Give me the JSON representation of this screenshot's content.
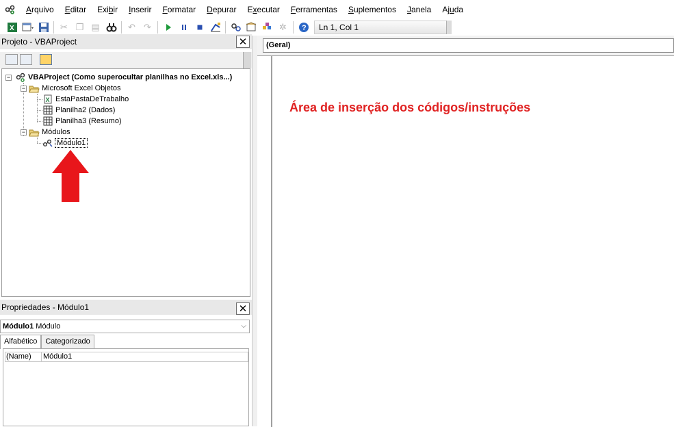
{
  "menubar": {
    "items": [
      {
        "pre": "",
        "u": "A",
        "post": "rquivo"
      },
      {
        "pre": "",
        "u": "E",
        "post": "ditar"
      },
      {
        "pre": "Exi",
        "u": "b",
        "post": "ir"
      },
      {
        "pre": "",
        "u": "I",
        "post": "nserir"
      },
      {
        "pre": "",
        "u": "F",
        "post": "ormatar"
      },
      {
        "pre": "",
        "u": "D",
        "post": "epurar"
      },
      {
        "pre": "E",
        "u": "x",
        "post": "ecutar"
      },
      {
        "pre": "",
        "u": "F",
        "post": "erramentas"
      },
      {
        "pre": "",
        "u": "S",
        "post": "uplementos"
      },
      {
        "pre": "",
        "u": "J",
        "post": "anela"
      },
      {
        "pre": "Aj",
        "u": "u",
        "post": "da"
      }
    ]
  },
  "toolbar": {
    "position_text": "Ln 1, Col 1",
    "icons": [
      "excel-icon",
      "insert-userform-icon",
      "save-icon",
      "cut-icon",
      "copy-icon",
      "paste-icon",
      "find-icon",
      "undo-icon",
      "redo-icon",
      "run-icon",
      "break-icon",
      "reset-icon",
      "design-mode-icon",
      "project-explorer-icon",
      "properties-window-icon",
      "object-browser-icon",
      "toolbox-icon",
      "help-icon"
    ]
  },
  "project": {
    "title": "Projeto - VBAProject",
    "close": "✕",
    "tree": {
      "root": "VBAProject (Como superocultar planilhas no Excel.xls...)",
      "excel_folder": "Microsoft Excel Objetos",
      "this_workbook": "EstaPastaDeTrabalho",
      "sheet2": "Planilha2 (Dados)",
      "sheet3": "Planilha3 (Resumo)",
      "modules_folder": "Módulos",
      "module1": "Módulo1"
    }
  },
  "properties": {
    "title": "Propriedades - Módulo1",
    "close": "✕",
    "object_name": "Módulo1",
    "object_type": "Módulo",
    "tabs": [
      "Alfabético",
      "Categorizado"
    ],
    "row_key": "(Name)",
    "row_value": "Módulo1"
  },
  "code": {
    "object_combo": "(Geral)",
    "annotation": "Área de inserção dos códigos/instruções"
  },
  "colors": {
    "annotation": "#e02222",
    "arrow": "#e8161b"
  }
}
